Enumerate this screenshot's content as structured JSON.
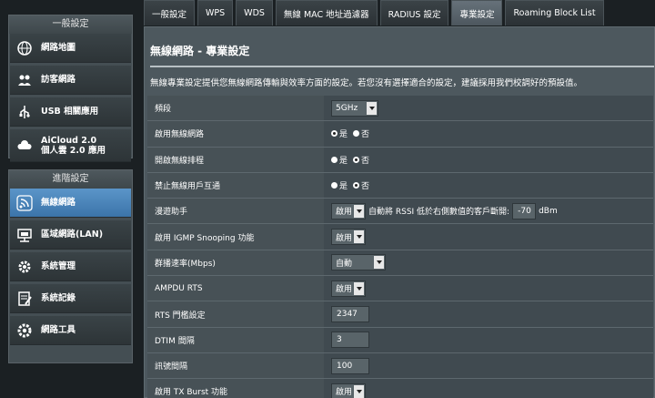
{
  "sidebar": {
    "group1_title": "一般設定",
    "group1_items": [
      {
        "label_line1": "網路地圖",
        "label_line2": ""
      },
      {
        "label_line1": "訪客網路",
        "label_line2": ""
      },
      {
        "label_line1": "USB 相關應用",
        "label_line2": ""
      },
      {
        "label_line1": "AiCloud 2.0",
        "label_line2": "個人雲 2.0 應用"
      }
    ],
    "group2_title": "進階設定",
    "group2_items": [
      {
        "label": "無線網路"
      },
      {
        "label": "區域網路(LAN)"
      },
      {
        "label": "系統管理"
      },
      {
        "label": "系統記錄"
      },
      {
        "label": "網路工具"
      }
    ]
  },
  "tabs": [
    "一般設定",
    "WPS",
    "WDS",
    "無線 MAC 地址過濾器",
    "RADIUS 設定",
    "專業設定",
    "Roaming Block List"
  ],
  "page": {
    "title": "無線網路 - 專業設定",
    "description": "無線專業設定提供您無線網路傳輸與效率方面的設定。若您沒有選擇適合的設定，建議採用我們校調好的預設值。"
  },
  "settings": {
    "band": {
      "label": "頻段",
      "value": "5GHz"
    },
    "enable_radio": {
      "label": "啟用無線網路",
      "yes": "是",
      "no": "否"
    },
    "enable_schedule": {
      "label": "開啟無線排程",
      "yes": "是",
      "no": "否"
    },
    "ap_isolation": {
      "label": "禁止無線用戶互通",
      "yes": "是",
      "no": "否"
    },
    "roaming_assistant": {
      "label": "漫遊助手",
      "select": "啟用",
      "text": "自動將 RSSI 低於右側數值的客戶斷開:",
      "rssi": "-70",
      "unit": "dBm"
    },
    "igmp_snooping": {
      "label": "啟用 IGMP Snooping 功能",
      "value": "啟用"
    },
    "multicast_rate": {
      "label": "群播速率(Mbps)",
      "value": "自動"
    },
    "ampdu_rts": {
      "label": "AMPDU RTS",
      "value": "啟用"
    },
    "rts_threshold": {
      "label": "RTS 門檻設定",
      "value": "2347"
    },
    "dtim_interval": {
      "label": "DTIM 間隔",
      "value": "3"
    },
    "beacon_interval": {
      "label": "訊號間隔",
      "value": "100"
    },
    "tx_burst": {
      "label": "啟用 TX Burst 功能",
      "value": "啟用"
    }
  },
  "colors": {
    "active_item": "#4a86bf",
    "panel": "#4d585e",
    "background": "#1b2023"
  }
}
